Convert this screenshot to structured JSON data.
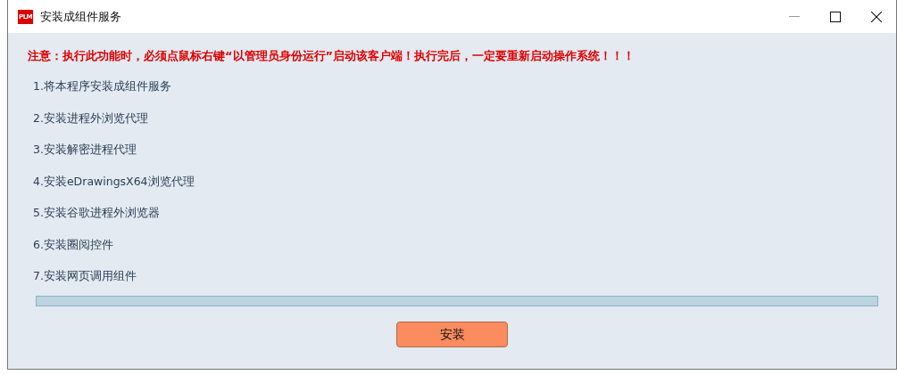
{
  "window": {
    "logo": "PLM",
    "title": "安装成组件服务"
  },
  "warning": "注意：执行此功能时，必须点鼠标右键“以管理员身份运行”启动该客户端！执行完后，一定要重新启动操作系统！！！",
  "steps": [
    "1.将本程序安装成组件服务",
    "2.安装进程外浏览代理",
    "3.安装解密进程代理",
    "4.安装eDrawingsX64浏览代理",
    "5.安装谷歌进程外浏览器",
    "6.安装圈阅控件",
    "7.安装网页调用组件"
  ],
  "progress": {
    "level": 0
  },
  "install_button": "安装"
}
